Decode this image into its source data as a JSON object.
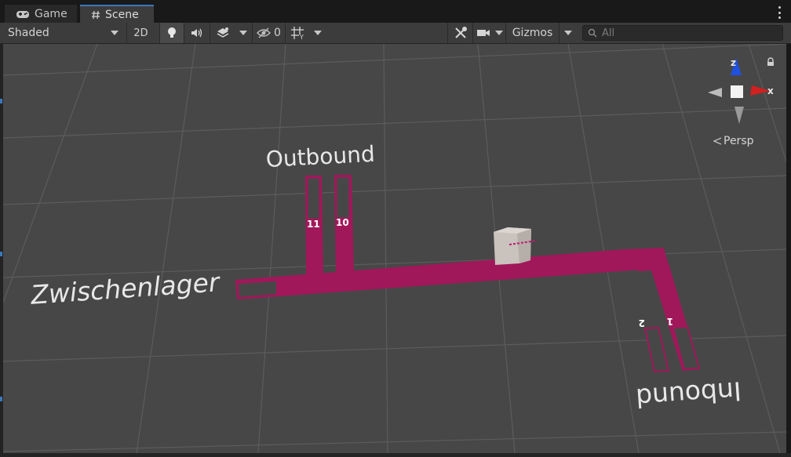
{
  "tabs": [
    {
      "label": "Game",
      "icon": "gamepad-icon",
      "active": false
    },
    {
      "label": "Scene",
      "icon": "hash-icon",
      "active": true
    }
  ],
  "toolbar": {
    "draw_mode": "Shaded",
    "mode_2d": "2D",
    "hidden_count": "0",
    "gizmos": "Gizmos",
    "search_placeholder": "All"
  },
  "scene": {
    "labels": {
      "outbound": "Outbound",
      "zwischenlager": "Zwischenlager",
      "inbound": "Inbound"
    },
    "slots": {
      "s11": "11",
      "s10": "10",
      "s2": "2",
      "s1": "1"
    },
    "track_color": "#a0185a"
  },
  "gizmo": {
    "x_label": "x",
    "z_label": "z",
    "projection": "Persp",
    "x_color": "#d02020",
    "z_color": "#2050e0"
  }
}
